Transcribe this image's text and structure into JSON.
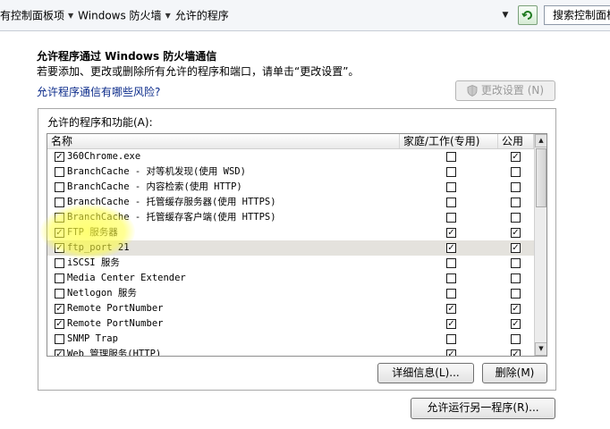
{
  "address_bar": {
    "crumbs": [
      "有控制面板项",
      "Windows 防火墙",
      "允许的程序"
    ],
    "search_placeholder": "搜索控制面板"
  },
  "title": "允许程序通过 Windows 防火墙通信",
  "description": "若要添加、更改或删除所有允许的程序和端口，请单击“更改设置”。",
  "risk_link": "允许程序通信有哪些风险?",
  "change_settings_label": "更改设置 (N)",
  "group_label": "允许的程序和功能(A):",
  "columns": {
    "name": "名称",
    "home_work": "家庭/工作(专用)",
    "public": "公用"
  },
  "rows": [
    {
      "name": "360Chrome.exe",
      "enabled": true,
      "home": false,
      "public": true
    },
    {
      "name": "BranchCache - 对等机发现(使用 WSD)",
      "enabled": false,
      "home": false,
      "public": false
    },
    {
      "name": "BranchCache - 内容检索(使用 HTTP)",
      "enabled": false,
      "home": false,
      "public": false
    },
    {
      "name": "BranchCache - 托管缓存服务器(使用 HTTPS)",
      "enabled": false,
      "home": false,
      "public": false
    },
    {
      "name": "BranchCache - 托管缓存客户端(使用 HTTPS)",
      "enabled": false,
      "home": false,
      "public": false
    },
    {
      "name": "FTP 服务器",
      "enabled": true,
      "home": true,
      "public": true
    },
    {
      "name": "ftp_port 21",
      "enabled": true,
      "home": true,
      "public": true,
      "selected": true
    },
    {
      "name": "iSCSI 服务",
      "enabled": false,
      "home": false,
      "public": false
    },
    {
      "name": "Media Center Extender",
      "enabled": false,
      "home": false,
      "public": false
    },
    {
      "name": "Netlogon 服务",
      "enabled": false,
      "home": false,
      "public": false
    },
    {
      "name": "Remote PortNumber",
      "enabled": true,
      "home": true,
      "public": true
    },
    {
      "name": "Remote PortNumber",
      "enabled": true,
      "home": true,
      "public": true
    },
    {
      "name": "SNMP Trap",
      "enabled": false,
      "home": false,
      "public": false
    },
    {
      "name": "Web 管理服务(HTTP)",
      "enabled": true,
      "home": true,
      "public": true
    }
  ],
  "details_label": "详细信息(L)...",
  "delete_label": "删除(M)",
  "allow_other_label": "允许运行另一程序(R)...",
  "colors": {
    "highlight": "#ffff3c",
    "selected_row": "#e4e2dd",
    "link": "#0a2a8a"
  }
}
